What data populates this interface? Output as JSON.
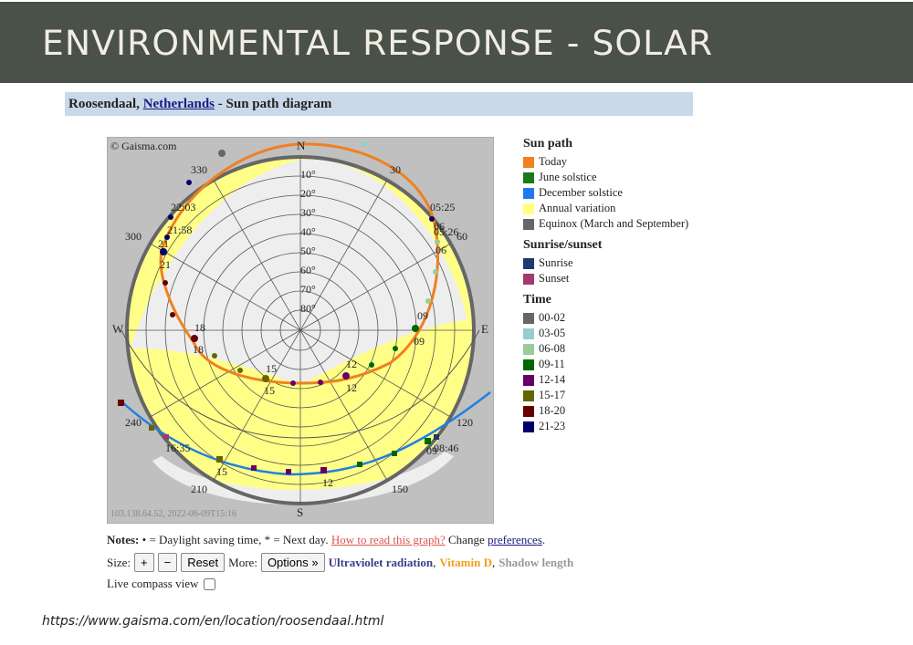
{
  "banner": {
    "title": "ENVIRONMENTAL RESPONSE - SOLAR"
  },
  "location": {
    "city": "Roosendaal,",
    "country": "Netherlands",
    "suffix": "- Sun path diagram"
  },
  "diagram": {
    "copyright": "© Gaisma.com",
    "footer": "103.138.64.52, 2022-06-09T15:16",
    "compass": {
      "north": "N",
      "east": "E",
      "south": "S",
      "west": "W"
    },
    "altitude_labels": [
      "10°",
      "20°",
      "30°",
      "40°",
      "50°",
      "60°",
      "70°",
      "80°"
    ],
    "azimuth_labels": [
      "330",
      "30",
      "60",
      "120",
      "150",
      "210",
      "240",
      "300"
    ],
    "time_labels": [
      "05:25",
      "06",
      "05:26",
      "06",
      "06",
      "09",
      "09",
      "12",
      "12",
      "15",
      "15",
      "18",
      "18",
      "21",
      "21",
      "21:58",
      "22:03",
      "08:46",
      "09",
      "12",
      "15",
      "16:35"
    ],
    "colors": {
      "today": "#f08020",
      "june": "#1a7a1a",
      "december": "#2080e0",
      "annual": "#ffff88",
      "equinox": "#666666",
      "outside": "#c0c0c0",
      "sky": "#eeeeee"
    }
  },
  "legend": {
    "sun_path": {
      "title": "Sun path",
      "items": [
        {
          "label": "Today",
          "color": "#f08020"
        },
        {
          "label": "June solstice",
          "color": "#1a7a1a"
        },
        {
          "label": "December solstice",
          "color": "#1f78f0"
        },
        {
          "label": "Annual variation",
          "color": "#ffff80"
        },
        {
          "label": "Equinox (March and September)",
          "color": "#666666"
        }
      ]
    },
    "sunrise_sunset": {
      "title": "Sunrise/sunset",
      "items": [
        {
          "label": "Sunrise",
          "color": "#1a3a70"
        },
        {
          "label": "Sunset",
          "color": "#a03a70"
        }
      ]
    },
    "time": {
      "title": "Time",
      "items": [
        {
          "label": "00-02",
          "color": "#666666"
        },
        {
          "label": "03-05",
          "color": "#99cccc"
        },
        {
          "label": "06-08",
          "color": "#99cc99"
        },
        {
          "label": "09-11",
          "color": "#006600"
        },
        {
          "label": "12-14",
          "color": "#660066"
        },
        {
          "label": "15-17",
          "color": "#666600"
        },
        {
          "label": "18-20",
          "color": "#660000"
        },
        {
          "label": "21-23",
          "color": "#000066"
        }
      ]
    }
  },
  "notes": {
    "prefix": "Notes:",
    "text": "• = Daylight saving time, * = Next day.",
    "how_to_read": "How to read this graph?",
    "change": "Change",
    "preferences": "preferences",
    "period": "."
  },
  "controls": {
    "size_label": "Size:",
    "plus": "+",
    "minus": "−",
    "reset": "Reset",
    "more_label": "More:",
    "options": "Options »",
    "uv": "Ultraviolet radiation",
    "comma1": ",",
    "vitamin": "Vitamin D",
    "comma2": ",",
    "shadow": "Shadow length",
    "uv_color": "#3c3c8c",
    "vitamin_color": "#f0a020",
    "shadow_color": "#999999"
  },
  "compass_view": {
    "label": "Live compass view",
    "checked": false
  },
  "source_url": "https://www.gaisma.com/en/location/roosendaal.html"
}
